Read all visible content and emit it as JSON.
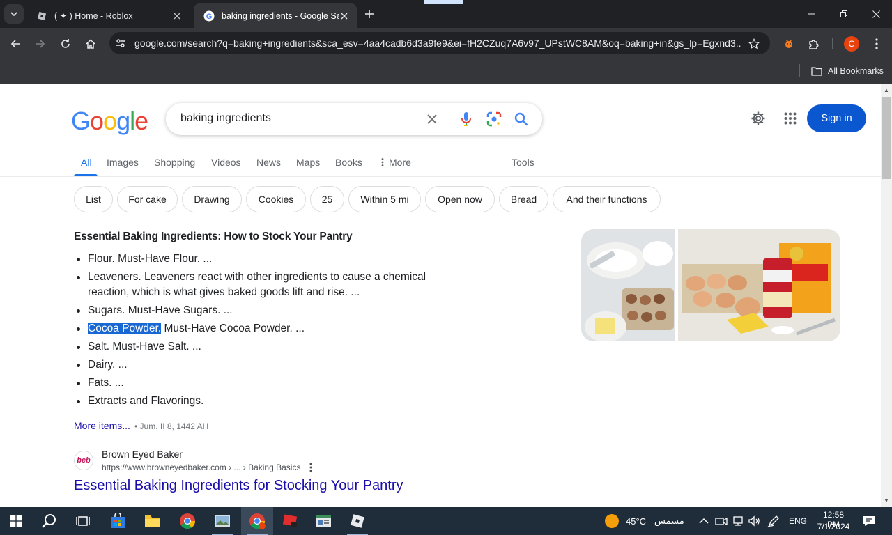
{
  "browser": {
    "tabs": [
      {
        "title": "( ✦ ) Home - Roblox"
      },
      {
        "title": "baking ingredients - Google Search"
      }
    ],
    "url": "google.com/search?q=baking+ingredients&sca_esv=4aa4cadb6d3a9fe9&ei=fH2CZuq7A6v97_UPstWC8AM&oq=baking+in&gs_lp=Egxnd3...",
    "profile_initial": "C",
    "bookmarks_label": "All Bookmarks"
  },
  "google": {
    "logo": "Google",
    "query": "baking ingredients",
    "signin_label": "Sign in",
    "nav_tabs": [
      "All",
      "Images",
      "Shopping",
      "Videos",
      "News",
      "Maps",
      "Books",
      "More",
      "Tools"
    ],
    "chips": [
      "List",
      "For cake",
      "Drawing",
      "Cookies",
      "25",
      "Within 5 mi",
      "Open now",
      "Bread",
      "And their functions"
    ],
    "snippet": {
      "title": "Essential Baking Ingredients: How to Stock Your Pantry",
      "items": [
        "Flour. Must-Have Flour. ...",
        "Leaveners. Leaveners react with other ingredients to cause a chemical reaction, which is what gives baked goods lift and rise. ...",
        "Sugars. Must-Have Sugars. ...",
        "Must-Have Cocoa Powder. ...",
        "Salt. Must-Have Salt. ...",
        "Dairy. ...",
        "Fats. ...",
        "Extracts and Flavorings."
      ],
      "highlighted_text": "Cocoa Powder.",
      "more_items": "More items...",
      "date": "Jum. II 8, 1442 AH"
    },
    "result": {
      "favicon_text": "beb",
      "site_name": "Brown Eyed Baker",
      "url": "https://www.browneyedbaker.com › ... › Baking Basics",
      "title": "Essential Baking Ingredients for Stocking Your Pantry"
    }
  },
  "taskbar": {
    "weather_temp": "45°C",
    "weather_desc": "مشمس",
    "language": "ENG",
    "time": "12:58 PM",
    "date": "7/1/2024"
  },
  "colors": {
    "link": "#1a0dab",
    "accent": "#1a73e8",
    "signin_bg": "#0b57d0",
    "highlight": "#1967d2"
  }
}
